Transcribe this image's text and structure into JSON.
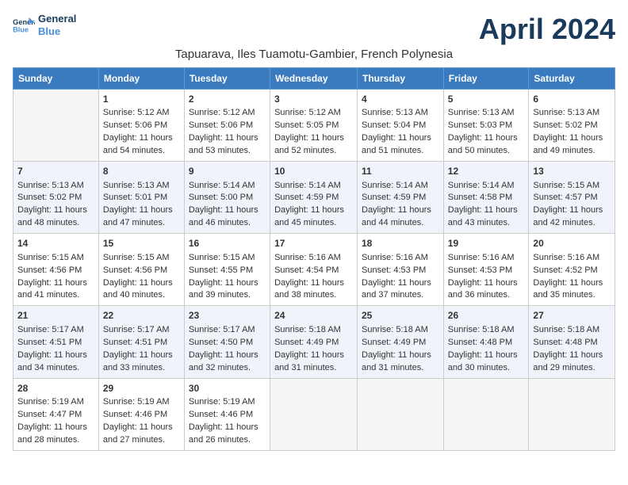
{
  "header": {
    "logo_general": "General",
    "logo_blue": "Blue",
    "title": "April 2024",
    "subtitle": "Tapuarava, Iles Tuamotu-Gambier, French Polynesia"
  },
  "columns": [
    "Sunday",
    "Monday",
    "Tuesday",
    "Wednesday",
    "Thursday",
    "Friday",
    "Saturday"
  ],
  "weeks": [
    [
      {
        "day": "",
        "empty": true
      },
      {
        "day": "1",
        "sunrise": "Sunrise: 5:12 AM",
        "sunset": "Sunset: 5:06 PM",
        "daylight": "Daylight: 11 hours and 54 minutes."
      },
      {
        "day": "2",
        "sunrise": "Sunrise: 5:12 AM",
        "sunset": "Sunset: 5:06 PM",
        "daylight": "Daylight: 11 hours and 53 minutes."
      },
      {
        "day": "3",
        "sunrise": "Sunrise: 5:12 AM",
        "sunset": "Sunset: 5:05 PM",
        "daylight": "Daylight: 11 hours and 52 minutes."
      },
      {
        "day": "4",
        "sunrise": "Sunrise: 5:13 AM",
        "sunset": "Sunset: 5:04 PM",
        "daylight": "Daylight: 11 hours and 51 minutes."
      },
      {
        "day": "5",
        "sunrise": "Sunrise: 5:13 AM",
        "sunset": "Sunset: 5:03 PM",
        "daylight": "Daylight: 11 hours and 50 minutes."
      },
      {
        "day": "6",
        "sunrise": "Sunrise: 5:13 AM",
        "sunset": "Sunset: 5:02 PM",
        "daylight": "Daylight: 11 hours and 49 minutes."
      }
    ],
    [
      {
        "day": "7",
        "sunrise": "Sunrise: 5:13 AM",
        "sunset": "Sunset: 5:02 PM",
        "daylight": "Daylight: 11 hours and 48 minutes."
      },
      {
        "day": "8",
        "sunrise": "Sunrise: 5:13 AM",
        "sunset": "Sunset: 5:01 PM",
        "daylight": "Daylight: 11 hours and 47 minutes."
      },
      {
        "day": "9",
        "sunrise": "Sunrise: 5:14 AM",
        "sunset": "Sunset: 5:00 PM",
        "daylight": "Daylight: 11 hours and 46 minutes."
      },
      {
        "day": "10",
        "sunrise": "Sunrise: 5:14 AM",
        "sunset": "Sunset: 4:59 PM",
        "daylight": "Daylight: 11 hours and 45 minutes."
      },
      {
        "day": "11",
        "sunrise": "Sunrise: 5:14 AM",
        "sunset": "Sunset: 4:59 PM",
        "daylight": "Daylight: 11 hours and 44 minutes."
      },
      {
        "day": "12",
        "sunrise": "Sunrise: 5:14 AM",
        "sunset": "Sunset: 4:58 PM",
        "daylight": "Daylight: 11 hours and 43 minutes."
      },
      {
        "day": "13",
        "sunrise": "Sunrise: 5:15 AM",
        "sunset": "Sunset: 4:57 PM",
        "daylight": "Daylight: 11 hours and 42 minutes."
      }
    ],
    [
      {
        "day": "14",
        "sunrise": "Sunrise: 5:15 AM",
        "sunset": "Sunset: 4:56 PM",
        "daylight": "Daylight: 11 hours and 41 minutes."
      },
      {
        "day": "15",
        "sunrise": "Sunrise: 5:15 AM",
        "sunset": "Sunset: 4:56 PM",
        "daylight": "Daylight: 11 hours and 40 minutes."
      },
      {
        "day": "16",
        "sunrise": "Sunrise: 5:15 AM",
        "sunset": "Sunset: 4:55 PM",
        "daylight": "Daylight: 11 hours and 39 minutes."
      },
      {
        "day": "17",
        "sunrise": "Sunrise: 5:16 AM",
        "sunset": "Sunset: 4:54 PM",
        "daylight": "Daylight: 11 hours and 38 minutes."
      },
      {
        "day": "18",
        "sunrise": "Sunrise: 5:16 AM",
        "sunset": "Sunset: 4:53 PM",
        "daylight": "Daylight: 11 hours and 37 minutes."
      },
      {
        "day": "19",
        "sunrise": "Sunrise: 5:16 AM",
        "sunset": "Sunset: 4:53 PM",
        "daylight": "Daylight: 11 hours and 36 minutes."
      },
      {
        "day": "20",
        "sunrise": "Sunrise: 5:16 AM",
        "sunset": "Sunset: 4:52 PM",
        "daylight": "Daylight: 11 hours and 35 minutes."
      }
    ],
    [
      {
        "day": "21",
        "sunrise": "Sunrise: 5:17 AM",
        "sunset": "Sunset: 4:51 PM",
        "daylight": "Daylight: 11 hours and 34 minutes."
      },
      {
        "day": "22",
        "sunrise": "Sunrise: 5:17 AM",
        "sunset": "Sunset: 4:51 PM",
        "daylight": "Daylight: 11 hours and 33 minutes."
      },
      {
        "day": "23",
        "sunrise": "Sunrise: 5:17 AM",
        "sunset": "Sunset: 4:50 PM",
        "daylight": "Daylight: 11 hours and 32 minutes."
      },
      {
        "day": "24",
        "sunrise": "Sunrise: 5:18 AM",
        "sunset": "Sunset: 4:49 PM",
        "daylight": "Daylight: 11 hours and 31 minutes."
      },
      {
        "day": "25",
        "sunrise": "Sunrise: 5:18 AM",
        "sunset": "Sunset: 4:49 PM",
        "daylight": "Daylight: 11 hours and 31 minutes."
      },
      {
        "day": "26",
        "sunrise": "Sunrise: 5:18 AM",
        "sunset": "Sunset: 4:48 PM",
        "daylight": "Daylight: 11 hours and 30 minutes."
      },
      {
        "day": "27",
        "sunrise": "Sunrise: 5:18 AM",
        "sunset": "Sunset: 4:48 PM",
        "daylight": "Daylight: 11 hours and 29 minutes."
      }
    ],
    [
      {
        "day": "28",
        "sunrise": "Sunrise: 5:19 AM",
        "sunset": "Sunset: 4:47 PM",
        "daylight": "Daylight: 11 hours and 28 minutes."
      },
      {
        "day": "29",
        "sunrise": "Sunrise: 5:19 AM",
        "sunset": "Sunset: 4:46 PM",
        "daylight": "Daylight: 11 hours and 27 minutes."
      },
      {
        "day": "30",
        "sunrise": "Sunrise: 5:19 AM",
        "sunset": "Sunset: 4:46 PM",
        "daylight": "Daylight: 11 hours and 26 minutes."
      },
      {
        "day": "",
        "empty": true
      },
      {
        "day": "",
        "empty": true
      },
      {
        "day": "",
        "empty": true
      },
      {
        "day": "",
        "empty": true
      }
    ]
  ]
}
